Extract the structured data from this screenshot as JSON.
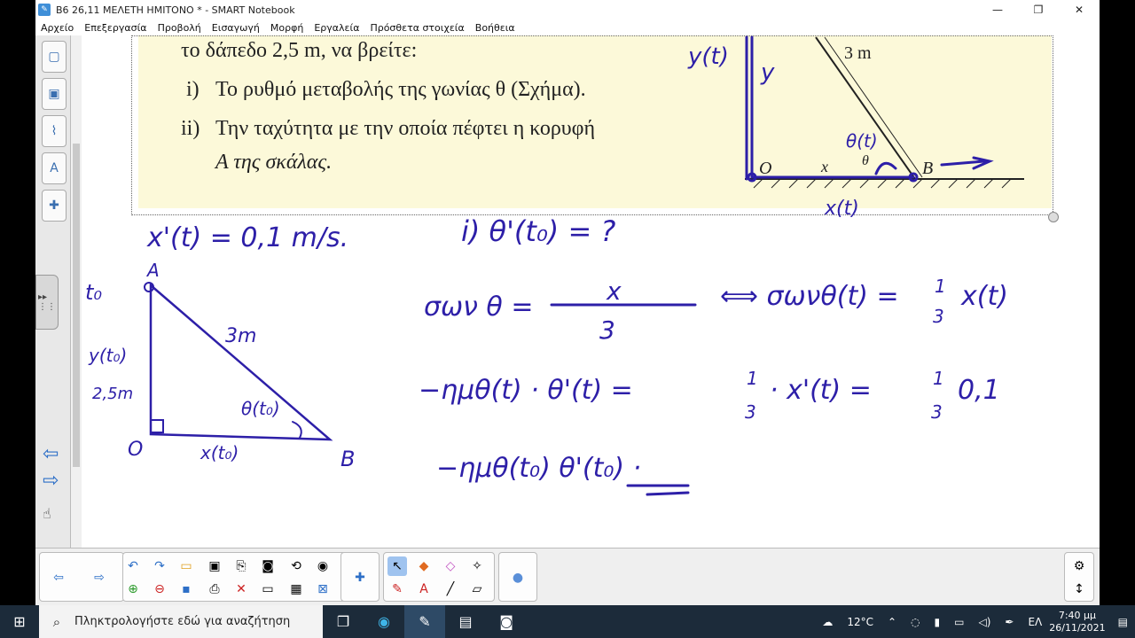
{
  "window": {
    "title": "B6 26,11 ΜΕΛΕΤΗ ΗΜΙΤΟΝΟ * - SMART Notebook",
    "minimize": "—",
    "maximize": "❐",
    "close": "✕"
  },
  "menu": [
    "Αρχείο",
    "Επεξεργασία",
    "Προβολή",
    "Εισαγωγή",
    "Μορφή",
    "Εργαλεία",
    "Πρόσθετα στοιχεία",
    "Βοήθεια"
  ],
  "problem": {
    "line1": "το δάπεδο 2,5 m, να βρείτε:",
    "item1_num": "i)",
    "item1": "Το ρυθμό μεταβολής της γωνίας θ (Σχήμα).",
    "item2_num": "ii)",
    "item2a": "Την ταχύτητα με την οποία πέφτει η κορυφή",
    "item2b": "A της σκάλας."
  },
  "figure": {
    "ladder": "3 m",
    "origin": "O",
    "x": "x",
    "theta": "θ",
    "b": "B"
  },
  "handwriting": {
    "yt": "y(t)",
    "y": "y",
    "theta_t": "θ(t)",
    "xt_top": "x(t)",
    "given": "x'(t) = 0,1 m/s.",
    "question": "i) θ'(t₀) = ?",
    "to": "t₀",
    "A": "A",
    "hyp": "3m",
    "y_to": "y(t₀)",
    "eq25": "2,5m",
    "O": "O",
    "B": "B",
    "x_to": "x(t₀)",
    "theta_to": "θ(t₀)",
    "eq1_lhs": "σων θ =",
    "eq1_num": "x",
    "eq1_den": "3",
    "eq1_rhs": "⟺ σωνθ(t) =",
    "third": "1",
    "three": "3",
    "eq1_end": "x(t)",
    "eq2_lhs": "−ημθ(t) · θ'(t) =",
    "eq2_mid": "· x'(t) =",
    "eq2_end": "0,1",
    "eq3": "−ημθ(t₀) θ'(t₀) ·"
  },
  "taskbar": {
    "search_placeholder": "Πληκτρολογήστε εδώ για αναζήτηση",
    "weather": "12°C",
    "lang": "ΕΛ",
    "time": "7:40 μμ",
    "date": "26/11/2021"
  },
  "colors": {
    "ink": "#2d1fa8",
    "yellow": "#fcf9d9",
    "taskbar": "#1c2b3a"
  }
}
